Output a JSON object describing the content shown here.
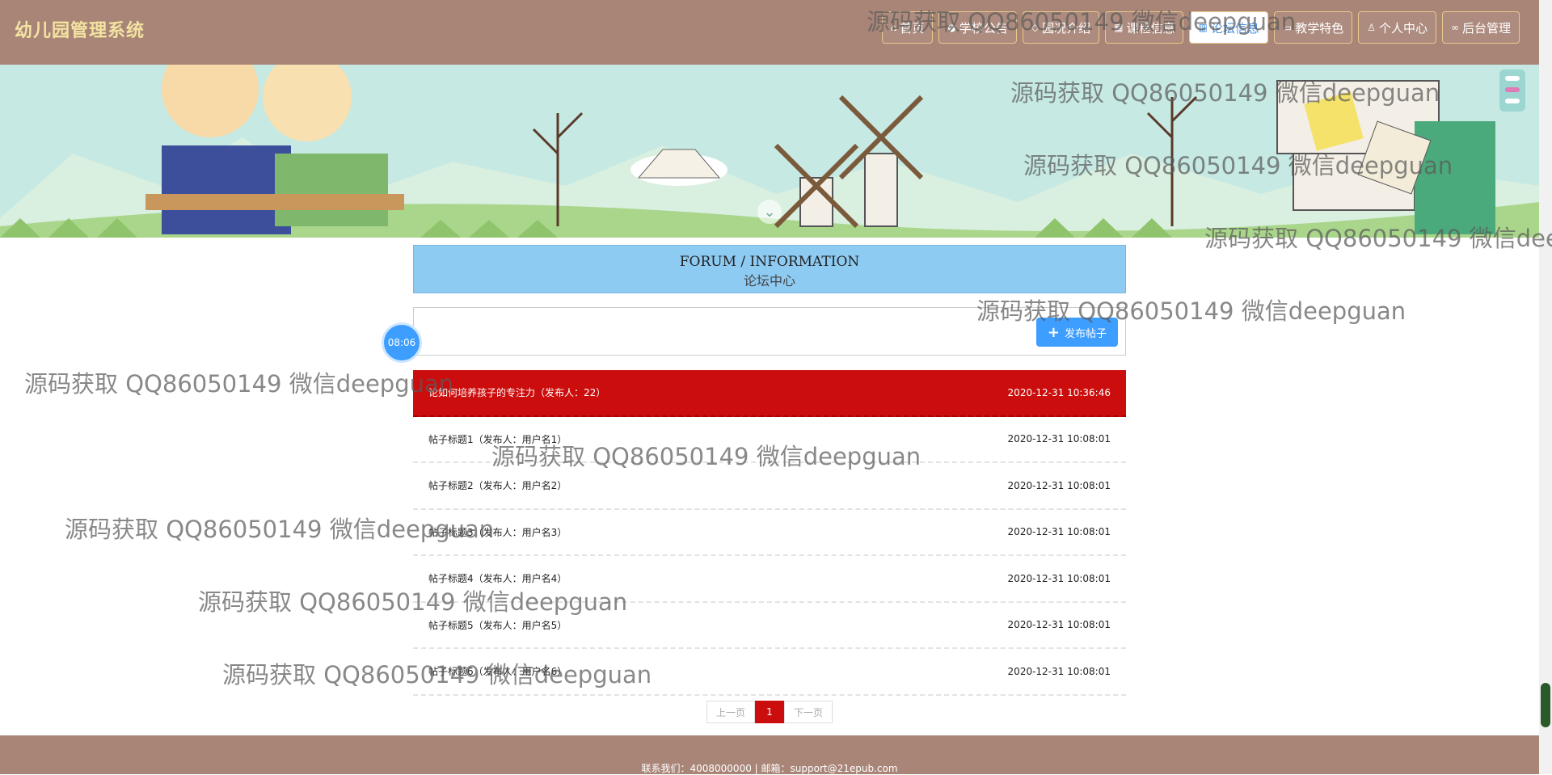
{
  "header": {
    "brand": "幼儿园管理系统",
    "nav": [
      {
        "icon": "home-icon",
        "glyph": "⌂",
        "label": "首页"
      },
      {
        "icon": "bullhorn-icon",
        "glyph": "◕",
        "label": "学校公告"
      },
      {
        "icon": "tag-icon",
        "glyph": "◇",
        "label": "园况介绍"
      },
      {
        "icon": "grid-icon",
        "glyph": "▦",
        "label": "课程信息"
      },
      {
        "icon": "book-icon",
        "glyph": "▥",
        "label": "论坛信息"
      },
      {
        "icon": "window-icon",
        "glyph": "▭",
        "label": "教学特色"
      },
      {
        "icon": "user-icon",
        "glyph": "♙",
        "label": "个人中心"
      },
      {
        "icon": "link-icon",
        "glyph": "∞",
        "label": "后台管理"
      }
    ],
    "active_index": 4
  },
  "forum": {
    "title_en": "FORUM / INFORMATION",
    "title_cn": "论坛中心",
    "post_button": "发布帖子",
    "clock": "08:06"
  },
  "posts": [
    {
      "title": "论如何培养孩子的专注力（发布人：22）",
      "time": "2020-12-31 10:36:46"
    },
    {
      "title": "帖子标题1（发布人：用户名1）",
      "time": "2020-12-31 10:08:01"
    },
    {
      "title": "帖子标题2（发布人：用户名2）",
      "time": "2020-12-31 10:08:01"
    },
    {
      "title": "帖子标题3（发布人：用户名3）",
      "time": "2020-12-31 10:08:01"
    },
    {
      "title": "帖子标题4（发布人：用户名4）",
      "time": "2020-12-31 10:08:01"
    },
    {
      "title": "帖子标题5（发布人：用户名5）",
      "time": "2020-12-31 10:08:01"
    },
    {
      "title": "帖子标题6（发布人：用户名6）",
      "time": "2020-12-31 10:08:01"
    }
  ],
  "pagination": {
    "prev": "上一页",
    "current": "1",
    "next": "下一页"
  },
  "footer": {
    "text": "联系我们：4008000000 | 邮箱：support@21epub.com"
  },
  "watermark": "源码获取 QQ86050149 微信deepguan",
  "colors": {
    "header_bg": "#a98578",
    "accent_red": "#cc0d0d",
    "forum_head_bg": "#8ecbf3",
    "button_blue": "#3d9eff"
  }
}
